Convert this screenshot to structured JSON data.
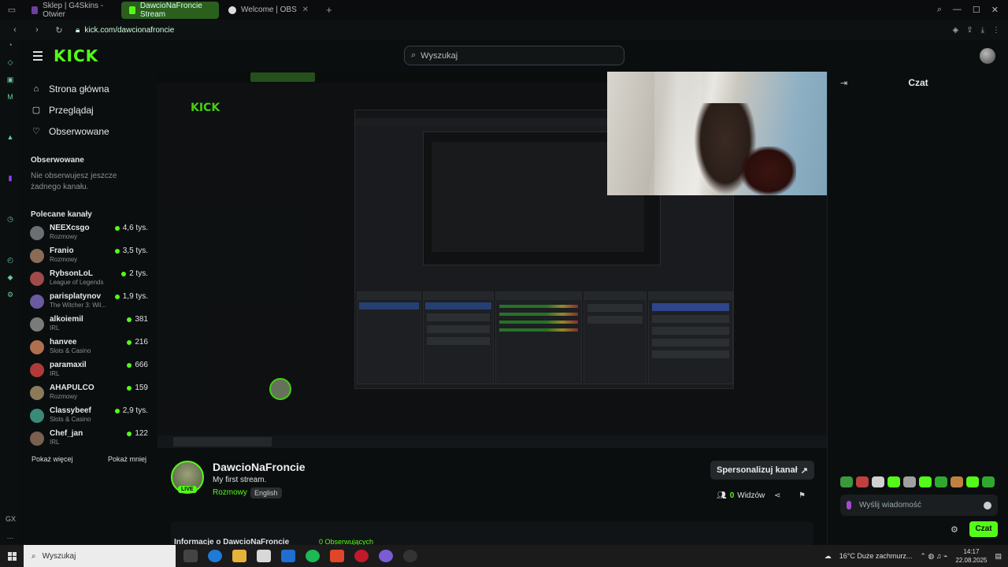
{
  "browser": {
    "tabs": [
      {
        "label": "Sklep | G4Skins - Otwier",
        "active": false
      },
      {
        "label": "DawcioNaFroncie Stream",
        "active": true
      },
      {
        "label": "Welcome | OBS",
        "active": false
      }
    ],
    "url": "kick.com/dawcionafroncie"
  },
  "header": {
    "search_placeholder": "Wyszukaj"
  },
  "nav": {
    "items": [
      {
        "icon": "home-icon",
        "label": "Strona główna"
      },
      {
        "icon": "browse-icon",
        "label": "Przeglądaj"
      },
      {
        "icon": "heart-icon",
        "label": "Obserwowane"
      }
    ],
    "followed_title": "Obserwowane",
    "followed_empty": "Nie obserwujesz jeszcze żadnego kanału.",
    "recommended_title": "Polecane kanały",
    "channels": [
      {
        "name": "NEEXcsgo",
        "category": "Rozmowy",
        "viewers": "4,6 tys.",
        "color": "#6b6e72"
      },
      {
        "name": "Franio",
        "category": "Rozmowy",
        "viewers": "3,5 tys.",
        "color": "#8a6b55"
      },
      {
        "name": "RybsonLoL",
        "category": "League of Legends",
        "viewers": "2 tys.",
        "color": "#a04a4a"
      },
      {
        "name": "parisplatynov",
        "category": "The Witcher 3: Wil...",
        "viewers": "1,9 tys.",
        "color": "#6a5aa0"
      },
      {
        "name": "alkoiemil",
        "category": "IRL",
        "viewers": "381",
        "color": "#7a7a7a"
      },
      {
        "name": "hanvee",
        "category": "Slots & Casino",
        "viewers": "216",
        "color": "#b07050"
      },
      {
        "name": "paramaxil",
        "category": "IRL",
        "viewers": "666",
        "color": "#b03a3a"
      },
      {
        "name": "AHAPULCO",
        "category": "Rozmowy",
        "viewers": "159",
        "color": "#8a7a5a"
      },
      {
        "name": "Classybeef",
        "category": "Slots & Casino",
        "viewers": "2,9 tys.",
        "color": "#3a8a7a"
      },
      {
        "name": "Chef_jan",
        "category": "IRL",
        "viewers": "122",
        "color": "#7a6050"
      }
    ],
    "show_more": "Pokaż więcej",
    "show_less": "Pokaż mniej"
  },
  "chat": {
    "title": "Czat",
    "input_placeholder": "Wyślij wiadomość",
    "send_label": "Czat"
  },
  "channel": {
    "name": "DawcioNaFroncie",
    "stream_title": "My first stream.",
    "category": "Rozmowy",
    "language": "English",
    "live_badge": "LIVE",
    "customize_label": "Spersonalizuj kanał",
    "viewers_count": "0",
    "viewers_label": "Widzów",
    "about_title": "Informacje o DawcioNaFroncie",
    "followers": "0 Obserwujących"
  },
  "taskbar": {
    "search_placeholder": "Wyszukaj",
    "weather": "16°C  Duże zachmurz...",
    "time": "14:17",
    "date": "22.08.2025"
  }
}
